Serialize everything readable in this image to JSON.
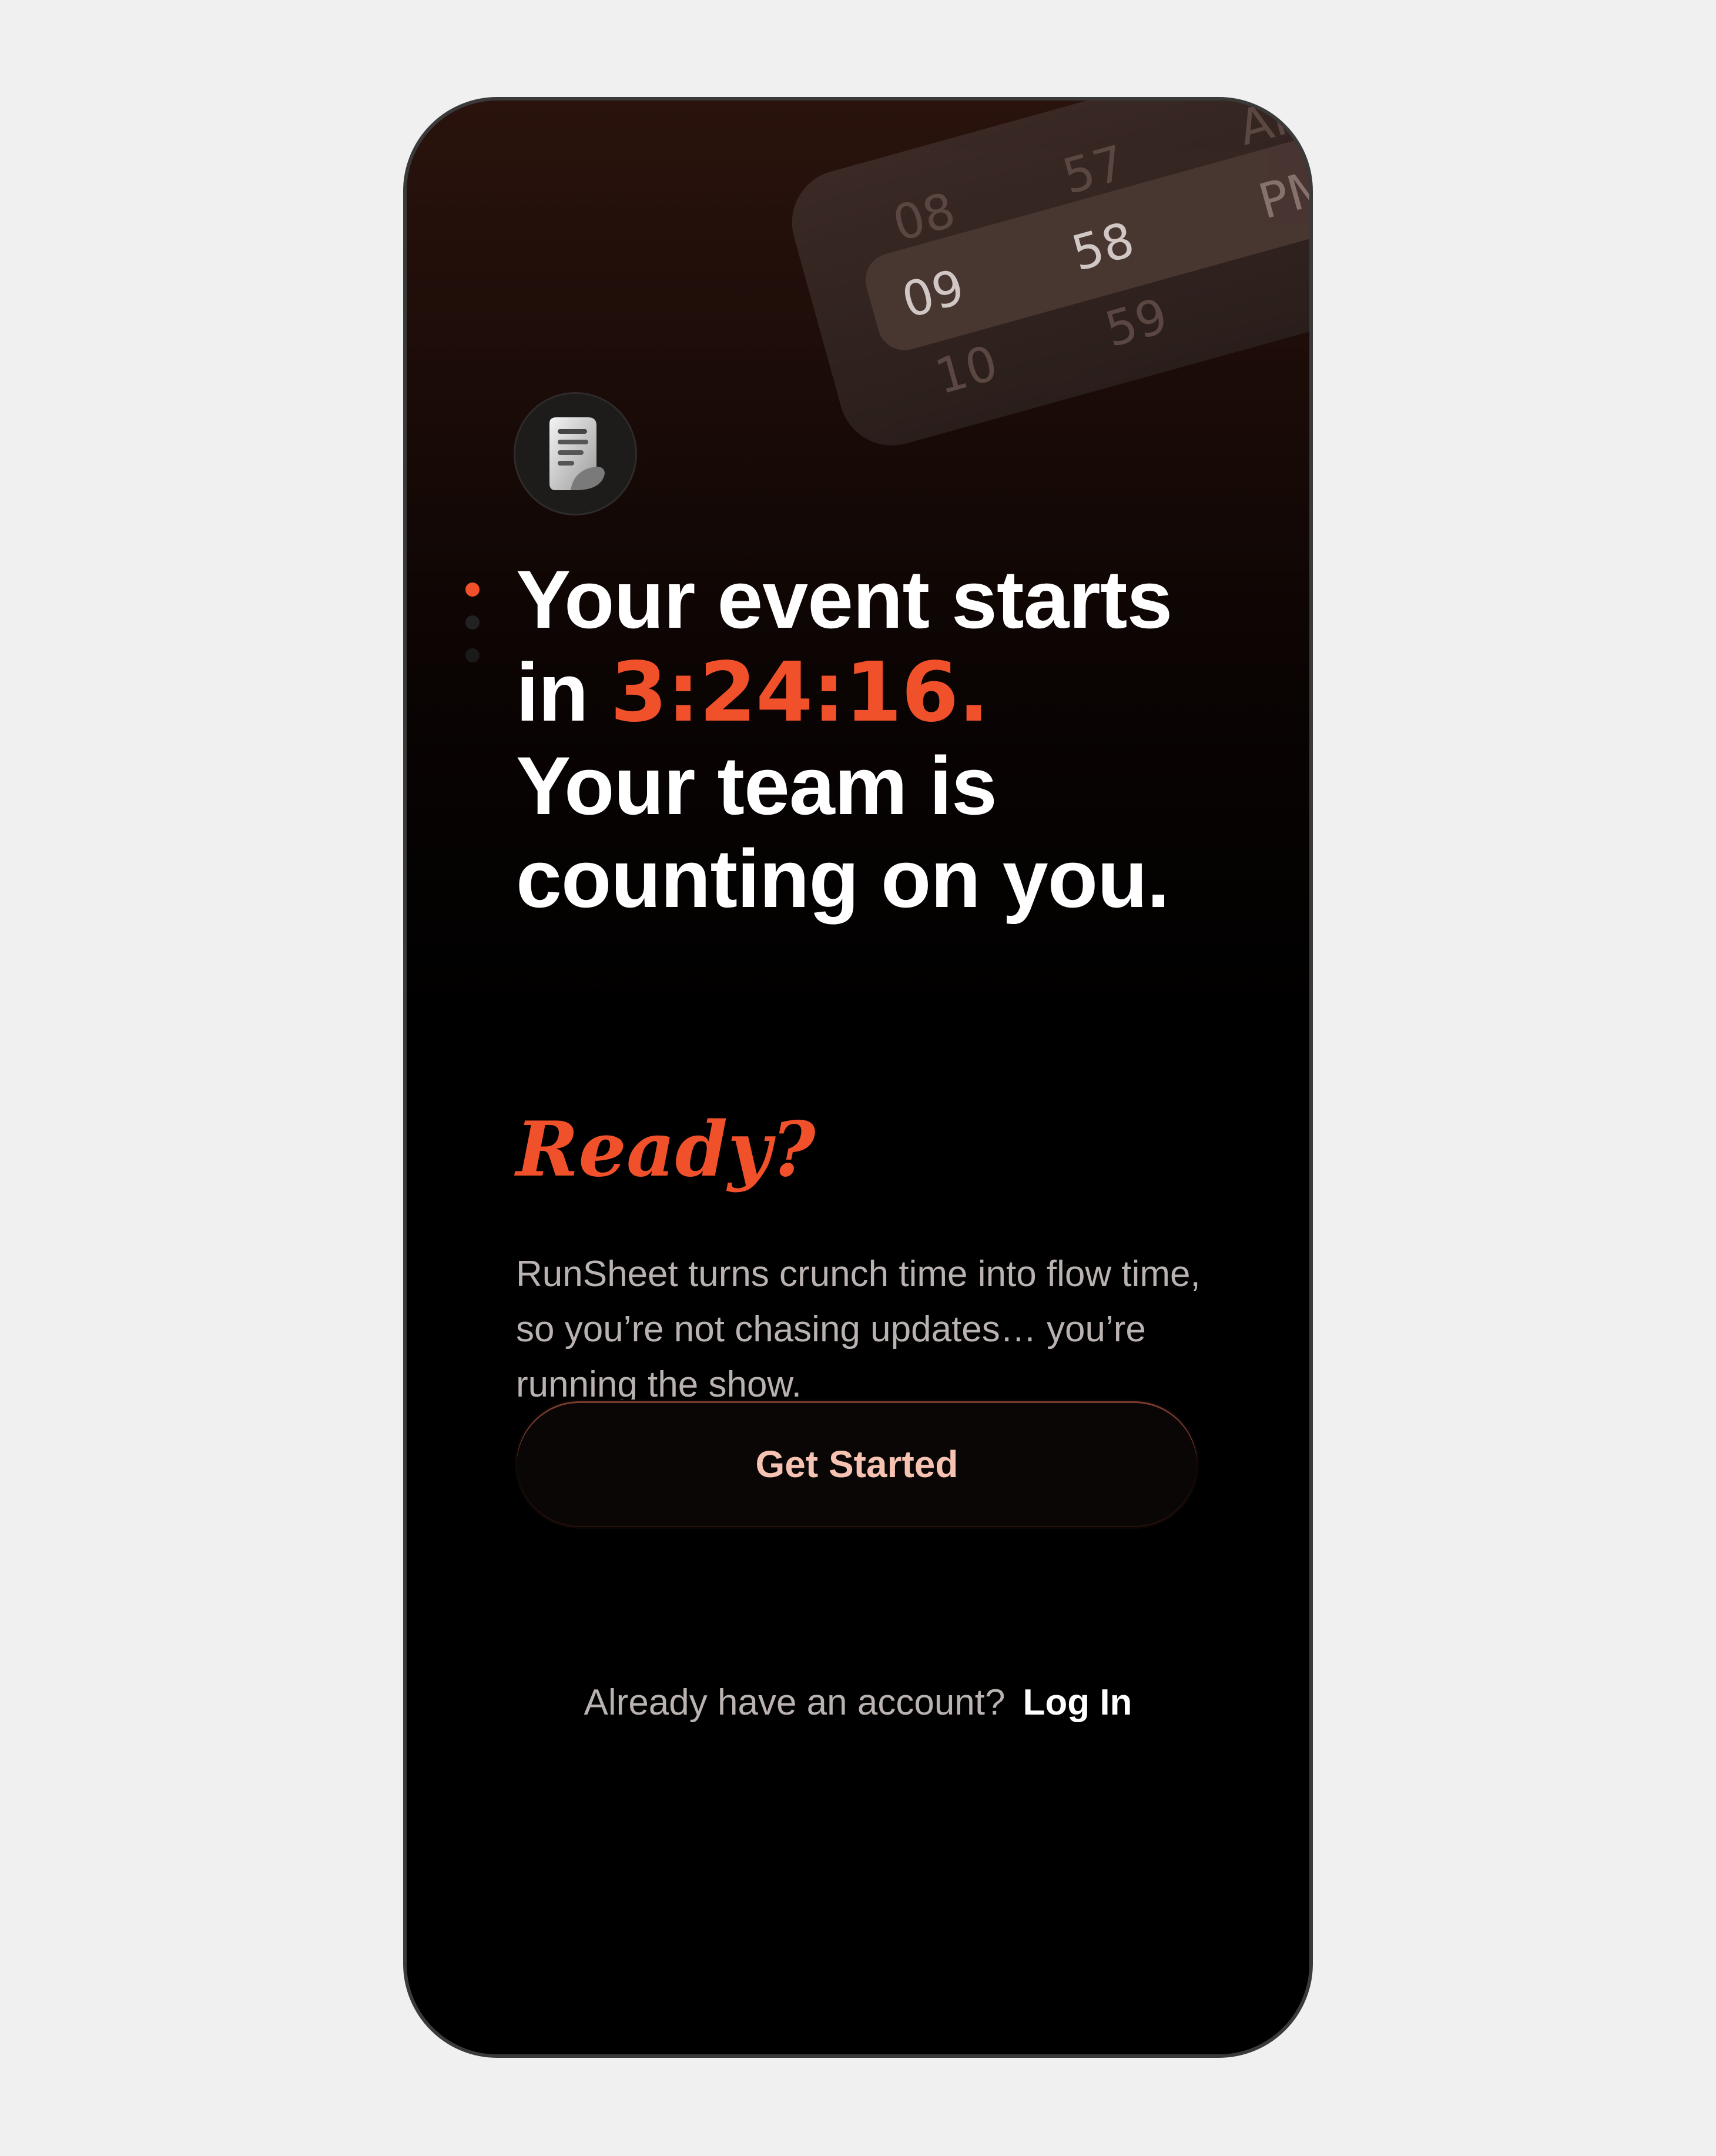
{
  "picker": {
    "hours": [
      "08",
      "09",
      "10"
    ],
    "minutes": [
      "57",
      "58",
      "59"
    ],
    "periods": [
      "AM",
      "PM"
    ]
  },
  "logo": {
    "icon": "document-icon"
  },
  "pager": {
    "count": 3,
    "active": 0
  },
  "headline": {
    "line1": "Your event starts",
    "line2_prefix": "in ",
    "countdown": "3:24:16.",
    "line3": "Your team is",
    "line4": "counting on you."
  },
  "ready": "Ready?",
  "description": "RunSheet turns crunch time into flow time, so you’re not chasing updates… you’re running the show.",
  "cta": {
    "label": "Get Started"
  },
  "login": {
    "prompt": "Already have an account?",
    "link": "Log In"
  },
  "colors": {
    "accent": "#f0502a",
    "background": "#000000",
    "button_text": "#f6c2b2"
  }
}
